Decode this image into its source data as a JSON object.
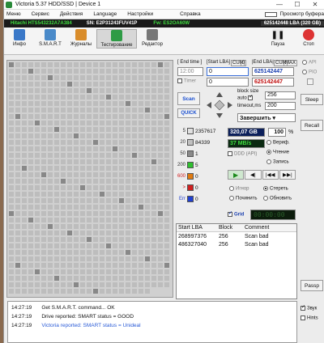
{
  "window": {
    "title": "Victoria 5.37 HDD/SSD | Device 1"
  },
  "menu": [
    "Меню",
    "Сервис",
    "Действия",
    "Language",
    "Настройки",
    "Справка"
  ],
  "menu_right": {
    "label": "Просмотр буфера"
  },
  "drive_info": {
    "model": "Hitachi HTS543232A7A384",
    "sn": "SN: E2P31243FUV41P",
    "fw": "Fw: ES2OA60W",
    "lba": "625142448 LBA (320 GB)"
  },
  "toolbar": [
    {
      "label": "Инфо",
      "icon": "info-icon",
      "color": "#3a78c8"
    },
    {
      "label": "S.M.A.R.T",
      "icon": "smart-icon",
      "color": "#4a8ac9"
    },
    {
      "label": "Журналы",
      "icon": "journal-icon",
      "color": "#d98c2a"
    },
    {
      "label": "Тестирование",
      "icon": "test-icon",
      "color": "#2e9b45"
    },
    {
      "label": "Редактор",
      "icon": "editor-icon",
      "color": "#777777"
    }
  ],
  "toolbar_right": [
    {
      "label": "Пауза",
      "icon": "pause-icon"
    },
    {
      "label": "Стоп",
      "icon": "stop-icon"
    }
  ],
  "range": {
    "end_time_label": "[ End time ]",
    "start_lba_label": "[Start LBA]",
    "cur_label": "CUR",
    "cur_value": "0",
    "end_lba_label": "|End LBA|",
    "end_cur": "CUR",
    "max_label": "MAX",
    "time_value": "12:00",
    "start_lba_value": "0",
    "end_lba_value": "625142447",
    "timer_label": "Timer",
    "timer_value": "0",
    "end_lba_value2": "625142447"
  },
  "scan": {
    "scan_label": "Scan",
    "quick_label": "QUICK",
    "block_size_label": "block size",
    "auto_label": "auto",
    "block_size_value": "256",
    "timeout_label": "timeout,ms",
    "timeout_value": "200",
    "action_select": "Завершить"
  },
  "stats": {
    "blocks": [
      {
        "ms": "5",
        "count": "2357617",
        "color": "#e0e0e0"
      },
      {
        "ms": "20",
        "count": "84339",
        "color": "#c0c0c0"
      },
      {
        "ms": "50",
        "count": "1",
        "color": "#8a8a8a"
      },
      {
        "ms": "200",
        "count": "5",
        "color": "#2fbf2f"
      },
      {
        "ms": "600",
        "count": "0",
        "color": "#e07a10"
      },
      {
        "ms": ">",
        "count": "0",
        "color": "#d02020"
      },
      {
        "ms": "Err",
        "count": "0",
        "color": "#2040d0"
      }
    ],
    "size_value": "320,07 GB",
    "percent_value": "100",
    "percent_unit": "%",
    "speed_value": "37 MB/s",
    "ddd_label": "DDD (API)",
    "verify_label": "Вериф.",
    "read_label": "Чтение",
    "write_label": "Запись",
    "ignore_label": "Игнор",
    "erase_label": "Стереть",
    "fix_label": "Починить",
    "refresh_label": "Обновить",
    "grid_label": "Grid",
    "grid_time": "00:00:00"
  },
  "bad_table": {
    "headers": [
      "Start LBA",
      "Block",
      "Comment"
    ],
    "rows": [
      [
        "268997376",
        "256",
        "Scan bad"
      ],
      [
        "486327040",
        "256",
        "Scan bad"
      ]
    ]
  },
  "log": [
    {
      "time": "14:27:19",
      "text": "Get S.M.A.R.T. command... OK",
      "color": "#111111"
    },
    {
      "time": "14:27:19",
      "text": "Drive reported: SMART status = GOOD",
      "color": "#111111"
    },
    {
      "time": "14:27:19",
      "text": "Victoria reported: SMART status = Unideal",
      "color": "#2a5bd7"
    }
  ],
  "side": {
    "api_label": "API",
    "pio_label": "PIO",
    "sleep_label": "Sleep",
    "recall_label": "Recall",
    "passp_label": "Passp",
    "sound_label": "Звук",
    "hints_label": "Hints"
  }
}
